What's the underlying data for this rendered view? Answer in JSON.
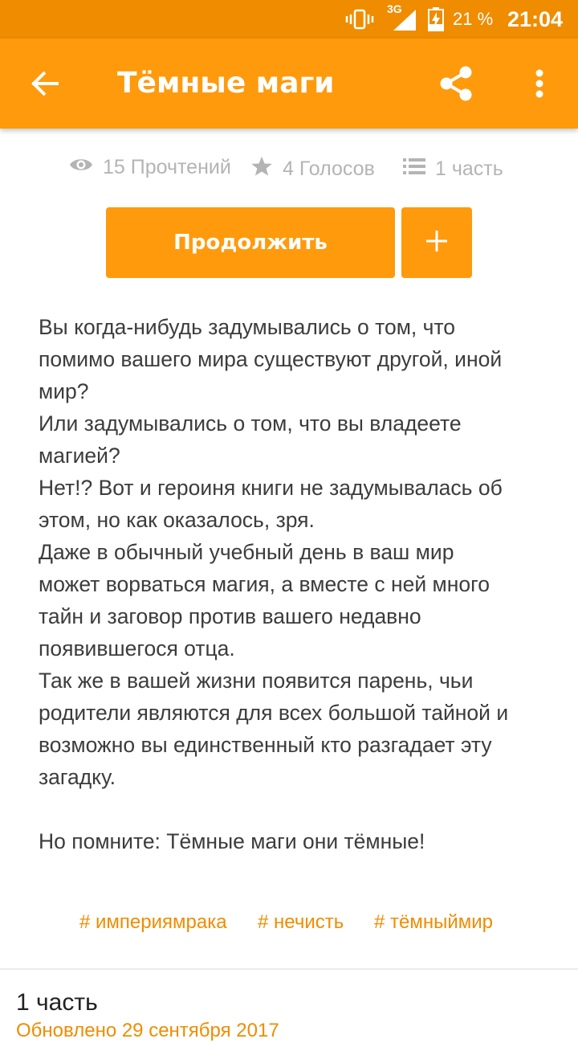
{
  "status_bar": {
    "network": "3G",
    "battery": "21 %",
    "time": "21:04",
    "icons": [
      "vibrate-icon",
      "signal-icon",
      "battery-charging-icon"
    ]
  },
  "app_bar": {
    "title": "Тёмные маги",
    "icons": [
      "back-arrow-icon",
      "share-icon",
      "more-vert-icon"
    ]
  },
  "stats": {
    "reads": "15 Прочтений",
    "votes": "4 Голосов",
    "parts": "1 часть",
    "icons": [
      "eye-icon",
      "star-icon",
      "list-icon"
    ]
  },
  "actions": {
    "continue_label": "Продолжить",
    "add_icon": "plus-icon"
  },
  "description": "Вы когда-нибудь задумывались о том, что\nпомимо вашего мира существуют другой, иной\nмир?\nИли задумывались о том, что вы владеете\nмагией?\nНет!? Вот и героиня книги не задумывалась об\nэтом, но как оказалось, зря.\nДаже в обычный учебный день в ваш мир\nможет ворваться магия, а вместе с ней много\nтайн и заговор против вашего недавно\nпоявившегося отца.\nТак же в вашей жизни появится парень, чьи\nродители являются для всех большой тайной и\nвозможно вы единственный кто разгадает эту\nзагадку.\n\nНо помните: Тёмные маги они тёмные!",
  "tags": [
    "# империямрака",
    "# нечисть",
    "# тёмныймир"
  ],
  "part": {
    "title": "1 часть",
    "date": "Обновлено 29 сентября 2017"
  },
  "colors": {
    "accent": "#ff9a0d",
    "status_bar": "#f08c00",
    "muted": "#b4b4b4",
    "text": "#3c3c3c"
  }
}
